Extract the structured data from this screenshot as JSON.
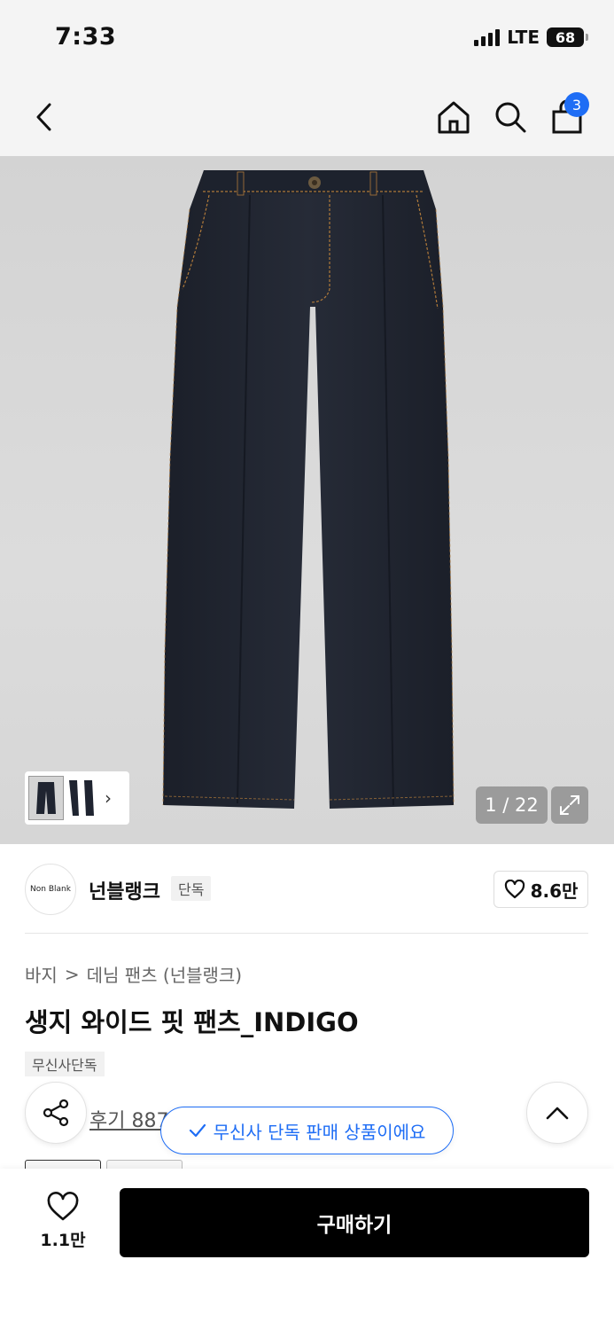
{
  "status_bar": {
    "time": "7:33",
    "network": "LTE",
    "battery": "68"
  },
  "nav": {
    "back_icon": "chevron-left-icon",
    "home_icon": "home-icon",
    "search_icon": "search-icon",
    "cart_icon": "shopping-bag-icon",
    "cart_count": "3"
  },
  "gallery": {
    "counter": "1 / 22",
    "thumb_arrow": "›",
    "expand_icon": "expand-icon"
  },
  "brand": {
    "logo_text": "Non Blank",
    "name": "넌블랭크",
    "tag": "단독",
    "likes": "8.6만"
  },
  "product": {
    "breadcrumb": [
      "바지",
      "데님 팬츠 (넌블랭크)"
    ],
    "breadcrumb_sep": ">",
    "title": "생지 와이드 핏 팬츠_INDIGO",
    "exclusive_tag": "무신사단독",
    "review_text": "후기 887"
  },
  "toast": {
    "text": "무신사 단독 판매 상품이에요"
  },
  "bottom_bar": {
    "wish_count": "1.1만",
    "buy_label": "구매하기"
  },
  "colors": {
    "accent": "#1e6df5",
    "buy_button": "#000000",
    "denim": "#1f2430",
    "stitch": "#b07a3a"
  }
}
